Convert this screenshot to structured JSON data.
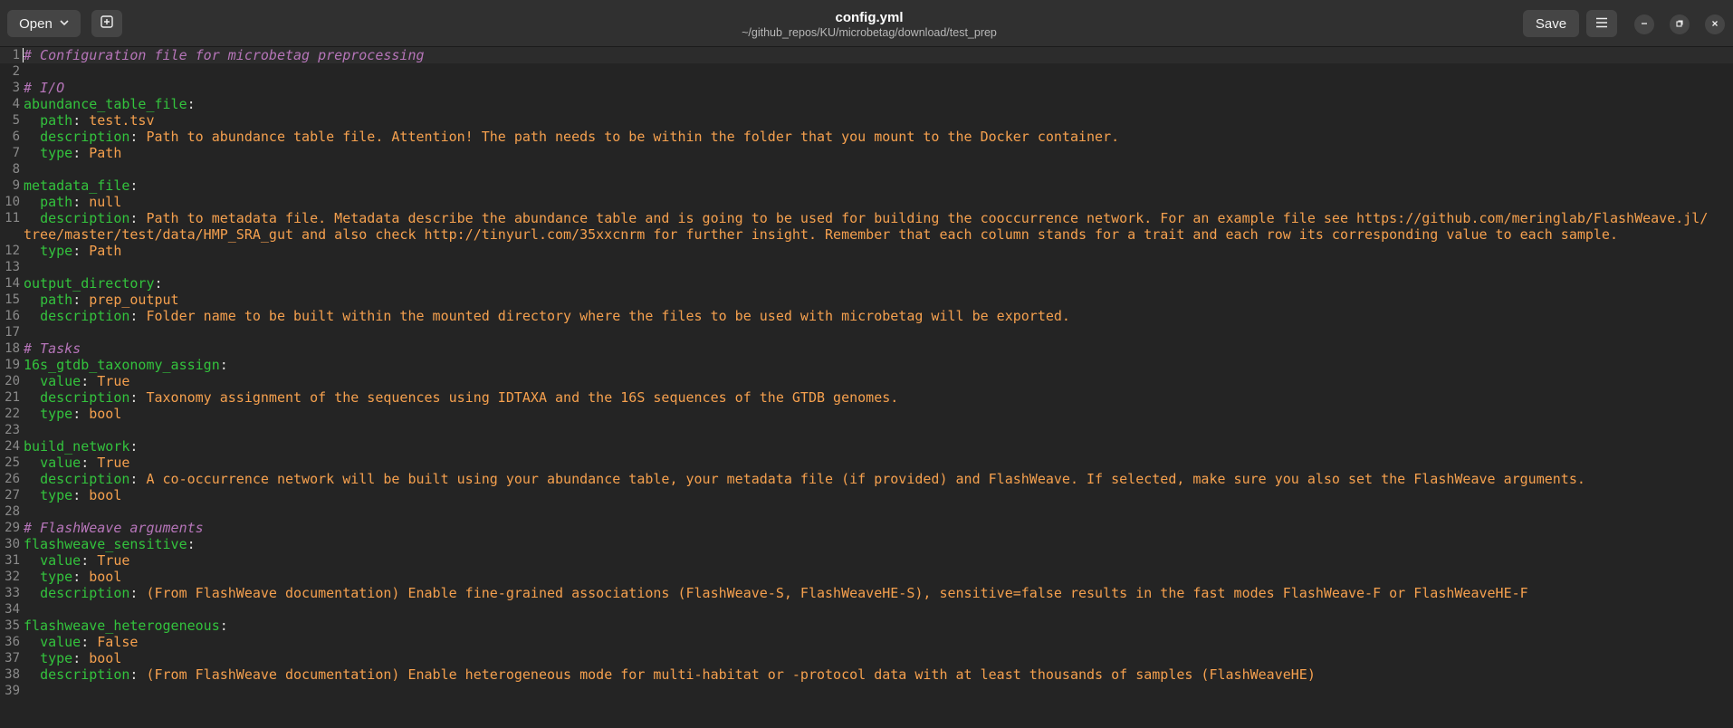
{
  "header": {
    "open_label": "Open",
    "title": "config.yml",
    "path": "~/github_repos/KU/microbetag/download/test_prep",
    "save_label": "Save"
  },
  "icons": {
    "open_dropdown": "chevron-down-icon",
    "new_tab": "new-tab-icon",
    "menu": "hamburger-menu-icon",
    "minimize": "minimize-icon",
    "maximize": "maximize-icon",
    "close": "close-icon"
  },
  "colors": {
    "background": "#242424",
    "key": "#33c33d",
    "value": "#f5a04e",
    "comment": "#b675b9"
  },
  "lines": [
    {
      "n": "1",
      "comment": "# Configuration file for microbetag preprocessing"
    },
    {
      "n": "2"
    },
    {
      "n": "3",
      "comment": "# I/O"
    },
    {
      "n": "4",
      "key": "abundance_table_file"
    },
    {
      "n": "5",
      "indent": "  ",
      "key": "path",
      "value": "test.tsv"
    },
    {
      "n": "6",
      "indent": "  ",
      "key": "description",
      "value": "Path to abundance table file. Attention! The path needs to be within the folder that you mount to the Docker container."
    },
    {
      "n": "7",
      "indent": "  ",
      "key": "type",
      "value": "Path"
    },
    {
      "n": "8"
    },
    {
      "n": "9",
      "key": "metadata_file"
    },
    {
      "n": "10",
      "indent": "  ",
      "key": "path",
      "value": "null"
    },
    {
      "n": "11",
      "indent": "  ",
      "key": "description",
      "value": "Path to metadata file. Metadata describe the abundance table and is going to be used for building the cooccurrence network. For an example file see https://github.com/meringlab/FlashWeave.jl/"
    },
    {
      "n": "",
      "value": "tree/master/test/data/HMP_SRA_gut and also check http://tinyurl.com/35xxcnrm for further insight. Remember that each column stands for a trait and each row its corresponding value to each sample."
    },
    {
      "n": "12",
      "indent": "  ",
      "key": "type",
      "value": "Path"
    },
    {
      "n": "13"
    },
    {
      "n": "14",
      "key": "output_directory"
    },
    {
      "n": "15",
      "indent": "  ",
      "key": "path",
      "value": "prep_output"
    },
    {
      "n": "16",
      "indent": "  ",
      "key": "description",
      "value": "Folder name to be built within the mounted directory where the files to be used with microbetag will be exported."
    },
    {
      "n": "17"
    },
    {
      "n": "18",
      "comment": "# Tasks"
    },
    {
      "n": "19",
      "key": "16s_gtdb_taxonomy_assign"
    },
    {
      "n": "20",
      "indent": "  ",
      "key": "value",
      "value": "True"
    },
    {
      "n": "21",
      "indent": "  ",
      "key": "description",
      "value": "Taxonomy assignment of the sequences using IDTAXA and the 16S sequences of the GTDB genomes."
    },
    {
      "n": "22",
      "indent": "  ",
      "key": "type",
      "value": "bool"
    },
    {
      "n": "23"
    },
    {
      "n": "24",
      "key": "build_network"
    },
    {
      "n": "25",
      "indent": "  ",
      "key": "value",
      "value": "True"
    },
    {
      "n": "26",
      "indent": "  ",
      "key": "description",
      "value": "A co-occurrence network will be built using your abundance table, your metadata file (if provided) and FlashWeave. If selected, make sure you also set the FlashWeave arguments."
    },
    {
      "n": "27",
      "indent": "  ",
      "key": "type",
      "value": "bool"
    },
    {
      "n": "28"
    },
    {
      "n": "29",
      "comment": "# FlashWeave arguments"
    },
    {
      "n": "30",
      "key": "flashweave_sensitive"
    },
    {
      "n": "31",
      "indent": "  ",
      "key": "value",
      "value": "True"
    },
    {
      "n": "32",
      "indent": "  ",
      "key": "type",
      "value": "bool"
    },
    {
      "n": "33",
      "indent": "  ",
      "key": "description",
      "value": "(From FlashWeave documentation) Enable fine-grained associations (FlashWeave-S, FlashWeaveHE-S), sensitive=false results in the fast modes FlashWeave-F or FlashWeaveHE-F"
    },
    {
      "n": "34"
    },
    {
      "n": "35",
      "key": "flashweave_heterogeneous"
    },
    {
      "n": "36",
      "indent": "  ",
      "key": "value",
      "value": "False"
    },
    {
      "n": "37",
      "indent": "  ",
      "key": "type",
      "value": "bool"
    },
    {
      "n": "38",
      "indent": "  ",
      "key": "description",
      "value": "(From FlashWeave documentation) Enable heterogeneous mode for multi-habitat or -protocol data with at least thousands of samples (FlashWeaveHE)"
    },
    {
      "n": "39"
    }
  ]
}
